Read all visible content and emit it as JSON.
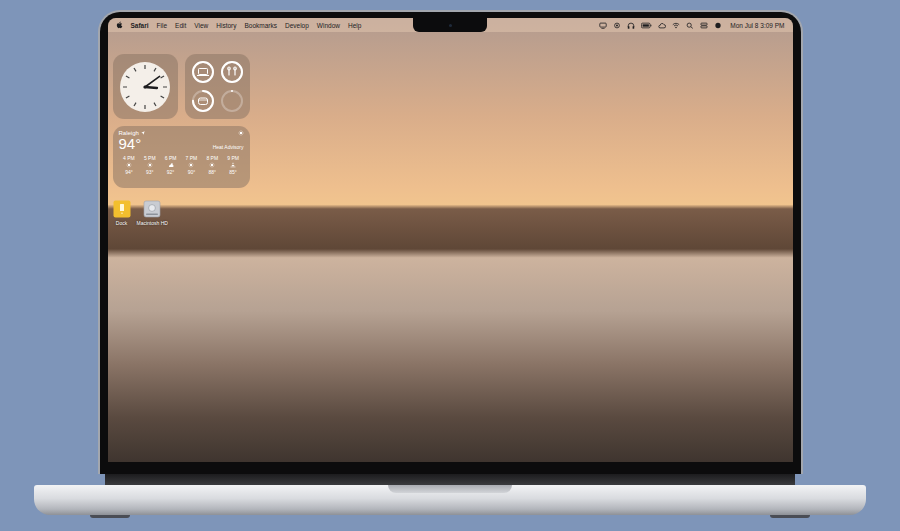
{
  "menu_bar": {
    "app": "Safari",
    "menus": [
      "File",
      "Edit",
      "View",
      "History",
      "Bookmarks",
      "Develop",
      "Window",
      "Help"
    ],
    "clock": "Mon Jul 8 3:09 PM"
  },
  "widgets": {
    "clock": {
      "hour": 3,
      "minute": 9
    },
    "batteries": [
      {
        "kind": "laptop",
        "level": 1
      },
      {
        "kind": "airpods",
        "level": 1
      },
      {
        "kind": "case",
        "level": 0.75
      },
      {
        "kind": "empty",
        "level": 0
      }
    ],
    "weather": {
      "location": "Raleigh",
      "temperature": "94°",
      "condition": "Heat Advisory",
      "forecast": [
        {
          "time": "4 PM",
          "kind": "sun",
          "temp": "94°"
        },
        {
          "time": "5 PM",
          "kind": "sun",
          "temp": "93°"
        },
        {
          "time": "6 PM",
          "kind": "cloud",
          "temp": "92°"
        },
        {
          "time": "7 PM",
          "kind": "sun",
          "temp": "90°"
        },
        {
          "time": "8 PM",
          "kind": "sun",
          "temp": "88°"
        },
        {
          "time": "9 PM",
          "kind": "sunset",
          "temp": "85°"
        }
      ]
    }
  },
  "desktop_icons": [
    {
      "label": "Dock",
      "kind": "folder"
    },
    {
      "label": "Macintosh HD",
      "kind": "drive"
    }
  ]
}
